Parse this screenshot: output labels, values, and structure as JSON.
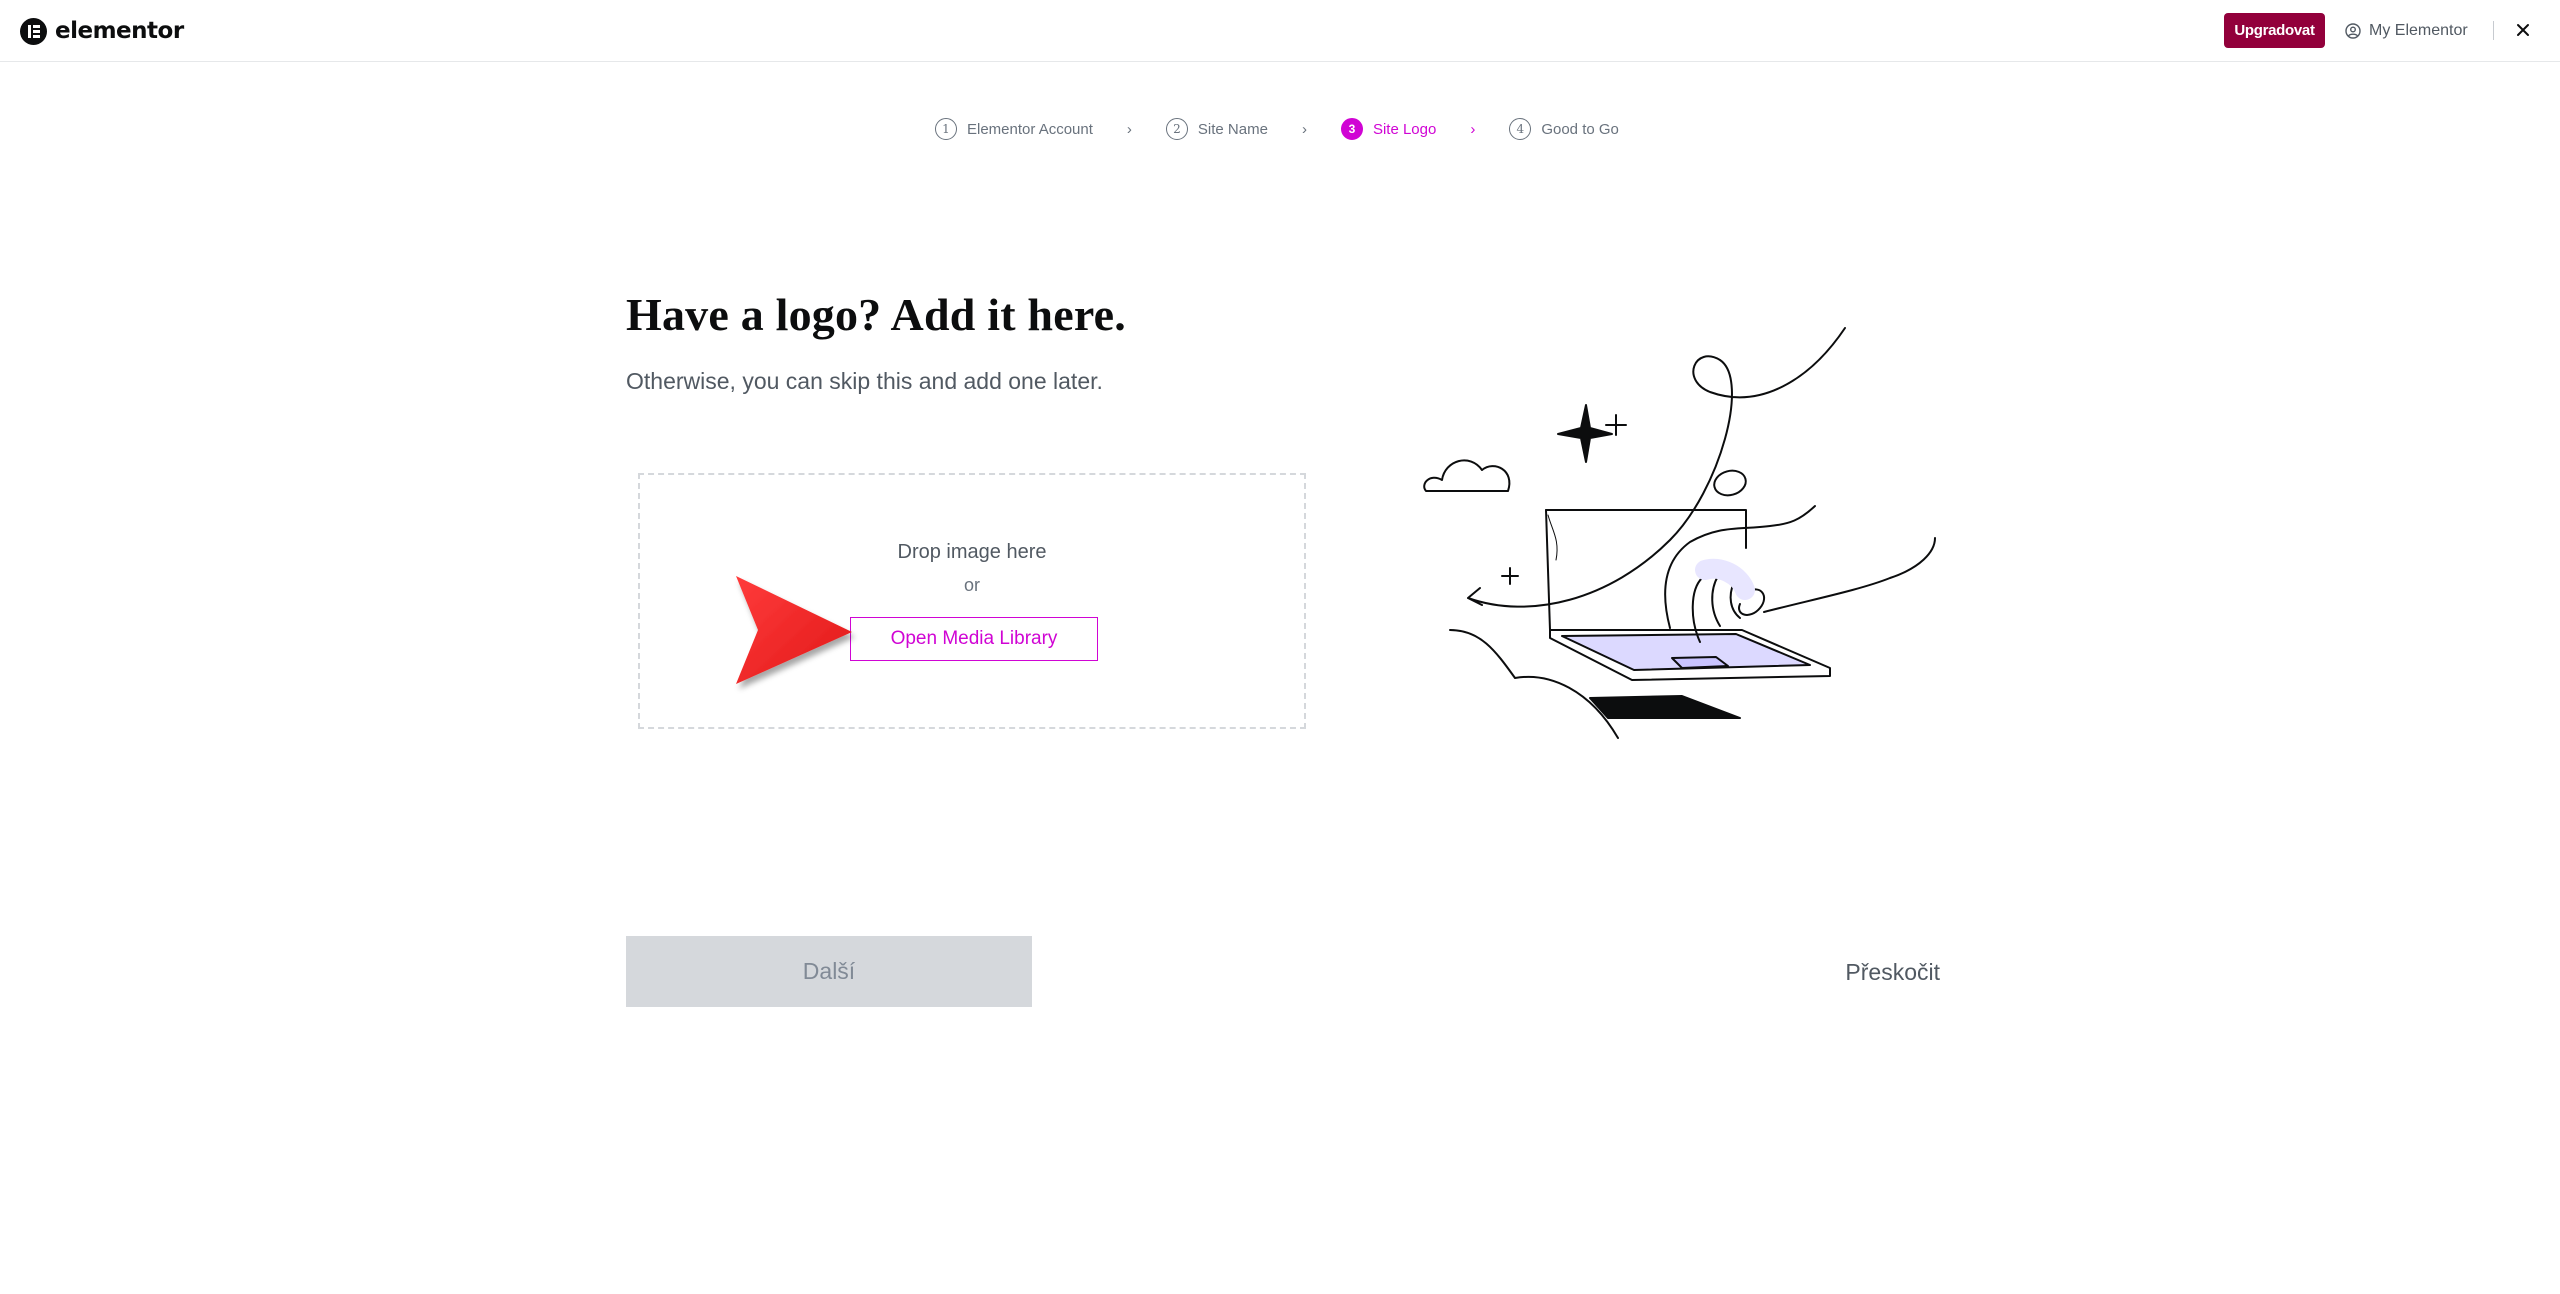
{
  "header": {
    "logo_text": "elementor",
    "upgrade_label": "Upgradovat",
    "account_label": "My Elementor"
  },
  "stepper": {
    "steps": [
      {
        "num": "1",
        "label": "Elementor Account",
        "state": "done"
      },
      {
        "num": "2",
        "label": "Site Name",
        "state": "done"
      },
      {
        "num": "3",
        "label": "Site Logo",
        "state": "active"
      },
      {
        "num": "4",
        "label": "Good to Go",
        "state": "upcoming"
      }
    ]
  },
  "main": {
    "title": "Have a logo? Add it here.",
    "subtitle": "Otherwise, you can skip this and add one later.",
    "dropzone": {
      "drop_text": "Drop image here",
      "or_text": "or",
      "button_label": "Open Media Library"
    }
  },
  "footer": {
    "next_label": "Další",
    "skip_label": "Přeskočit"
  },
  "colors": {
    "accent": "#d004d4",
    "upgrade": "#92003b",
    "annotation_arrow": "#f02c2c",
    "disabled_button": "#d5d8dc"
  },
  "icons": [
    "elementor-logo-icon",
    "user-circle-icon",
    "close-icon",
    "chevron-right-icon"
  ]
}
